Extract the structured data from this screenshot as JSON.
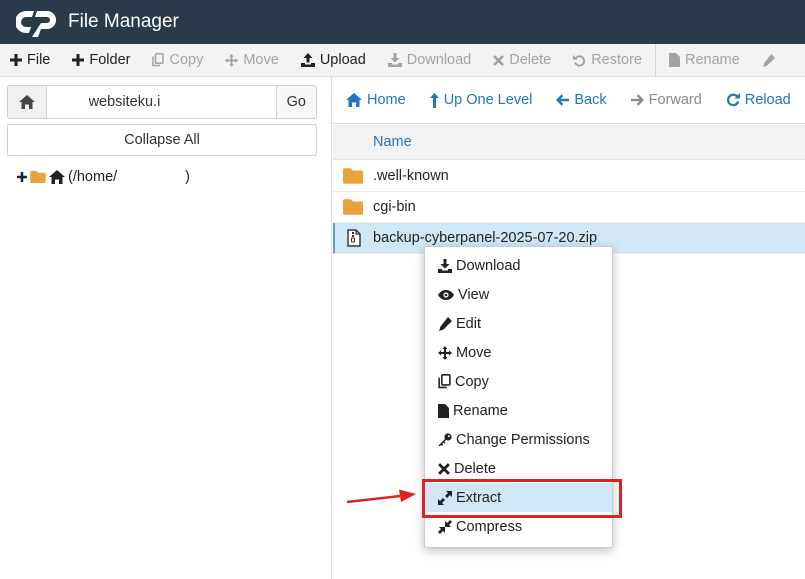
{
  "app": {
    "title": "File Manager",
    "logo": "cpanel-logo"
  },
  "toolbar": {
    "file_label": "File",
    "folder_label": "Folder",
    "copy_label": "Copy",
    "move_label": "Move",
    "upload_label": "Upload",
    "download_label": "Download",
    "delete_label": "Delete",
    "restore_label": "Restore",
    "rename_label": "Rename"
  },
  "left": {
    "path_value": "websiteku.i",
    "go_label": "Go",
    "collapse_label": "Collapse All",
    "tree_root_label": "(/home/",
    "tree_root_suffix": ")"
  },
  "nav": {
    "home_label": "Home",
    "up_label": "Up One Level",
    "back_label": "Back",
    "forward_label": "Forward",
    "reload_label": "Reload"
  },
  "list": {
    "name_header": "Name",
    "rows": [
      {
        "name": ".well-known",
        "icon": "folder-icon"
      },
      {
        "name": "cgi-bin",
        "icon": "folder-icon"
      },
      {
        "name": "backup-cyberpanel-2025-07-20.zip",
        "icon": "zip-file-icon",
        "selected": true
      }
    ]
  },
  "context_menu": {
    "items": [
      {
        "label": "Download",
        "icon": "download-icon"
      },
      {
        "label": "View",
        "icon": "eye-icon"
      },
      {
        "label": "Edit",
        "icon": "pencil-icon"
      },
      {
        "label": "Move",
        "icon": "move-icon"
      },
      {
        "label": "Copy",
        "icon": "copy-icon"
      },
      {
        "label": "Rename",
        "icon": "file-icon"
      },
      {
        "label": "Change Permissions",
        "icon": "key-icon"
      },
      {
        "label": "Delete",
        "icon": "x-icon"
      },
      {
        "label": "Extract",
        "icon": "expand-icon",
        "active": true
      },
      {
        "label": "Compress",
        "icon": "compress-icon"
      }
    ]
  },
  "colors": {
    "header_bg": "#293a4a",
    "link": "#2177b8",
    "highlight": "#e02020",
    "selected_row": "#cfe7f6"
  }
}
